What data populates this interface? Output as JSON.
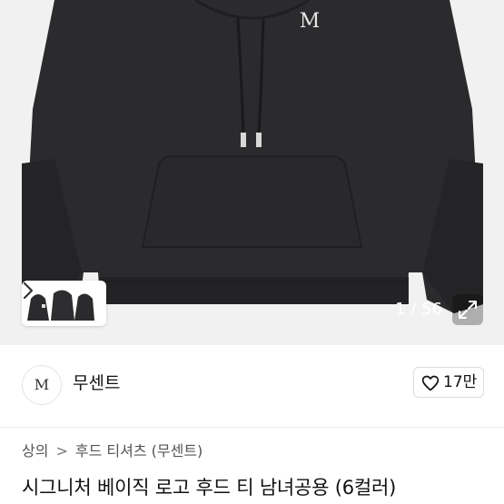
{
  "gallery": {
    "counter": "1 / 56",
    "chest_logo": "M"
  },
  "brand": {
    "logo_text": "M",
    "name": "무센트",
    "likes": "17만"
  },
  "breadcrumb": {
    "items": [
      "상의",
      "후드 티셔츠 (무센트)"
    ],
    "separator": ">"
  },
  "product": {
    "title": "시그니처 베이직 로고 후드 티 남녀공용 (6컬러)"
  },
  "colors": {
    "hoodie": "#2b2b2d",
    "background": "#f1f1f1"
  },
  "icons": [
    "chevron-right-icon",
    "expand-icon",
    "heart-icon"
  ]
}
